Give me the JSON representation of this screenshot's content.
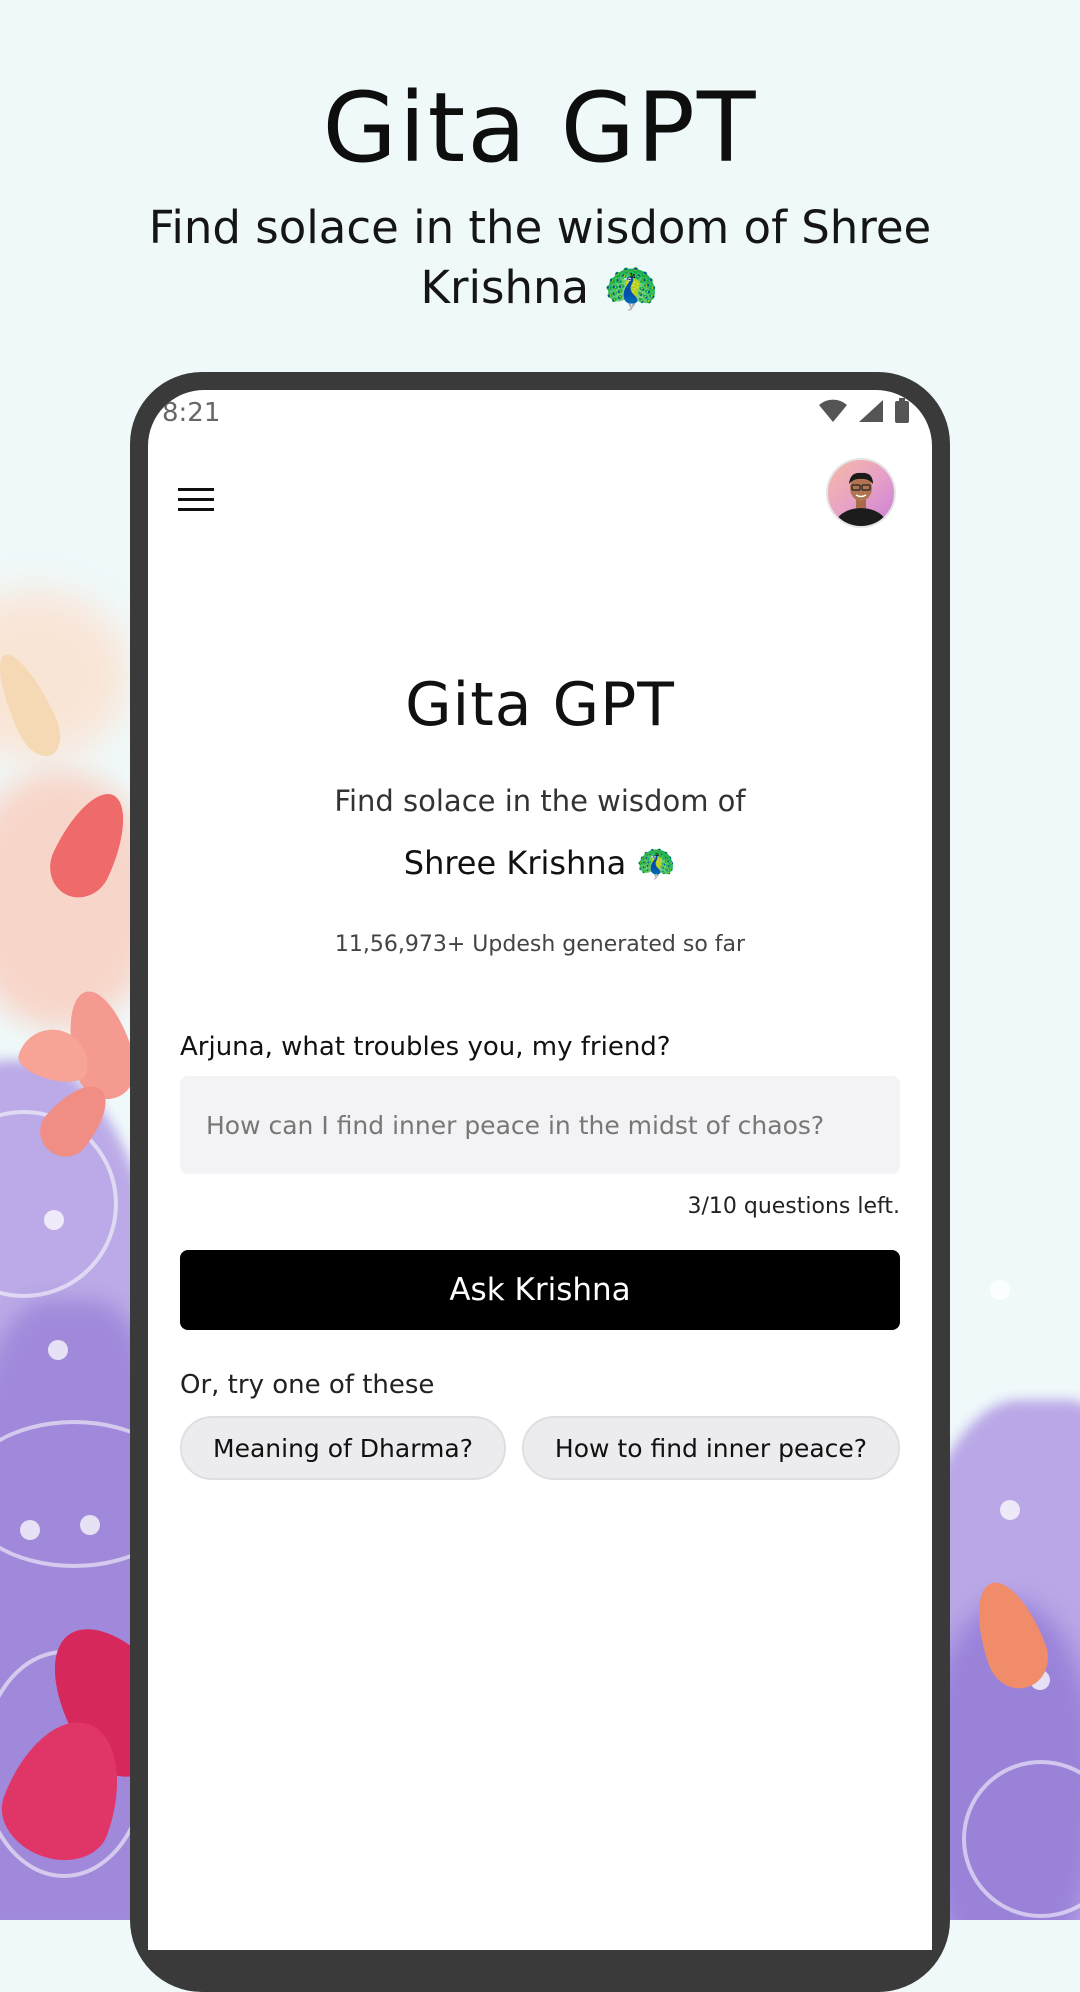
{
  "hero": {
    "title": "Gita GPT",
    "subtitle": "Find solace in the wisdom of Shree Krishna 🦚"
  },
  "status_bar": {
    "time": "8:21",
    "icons": [
      "wifi-icon",
      "signal-icon",
      "battery-icon"
    ]
  },
  "app_header": {
    "menu_icon": "hamburger-menu-icon",
    "avatar": "user-avatar"
  },
  "main": {
    "title": "Gita GPT",
    "subtitle_line1": "Find solace in the wisdom of",
    "subtitle_line2": "Shree Krishna 🦚",
    "counter": "11,56,973+ Updesh generated so far",
    "prompt_label": "Arjuna, what troubles you, my friend?",
    "input_placeholder": "How can I find inner peace in the midst of chaos?",
    "input_value": "",
    "questions_left": "3/10 questions left.",
    "ask_button": "Ask Krishna",
    "try_label": "Or, try one of these",
    "suggestions": [
      "Meaning of Dharma?",
      "How to find inner peace?"
    ]
  },
  "colors": {
    "page_background": "#eff9fa",
    "button": "#000000",
    "chip": "#ececef",
    "input": "#f3f3f5",
    "phone_frame": "#3a3a3a"
  }
}
